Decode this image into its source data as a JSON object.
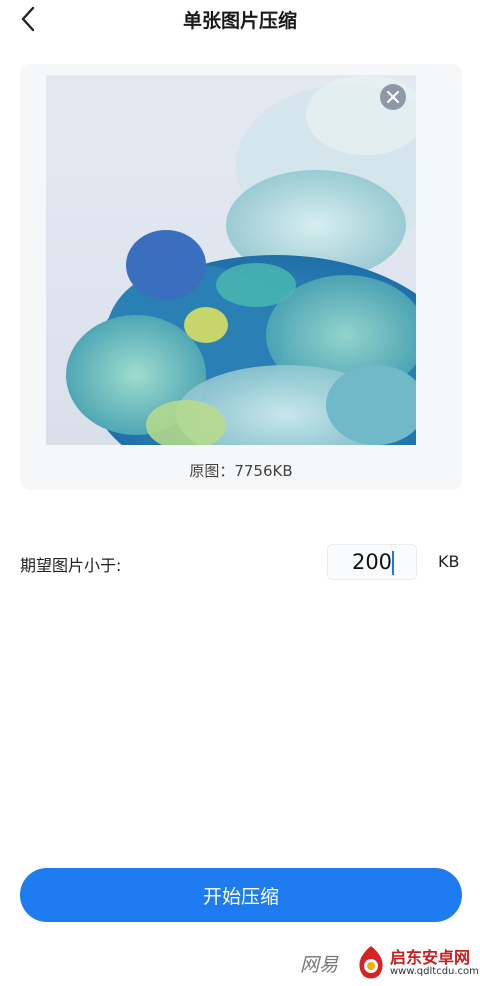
{
  "header": {
    "title": "单张图片压缩",
    "back_icon": "chevron-left-icon"
  },
  "preview": {
    "remove_icon": "close-icon",
    "original_label": "原图：7756KB"
  },
  "target": {
    "label": "期望图片小于:",
    "value": "200",
    "unit": "KB"
  },
  "actions": {
    "start_label": "开始压缩"
  },
  "watermark": {
    "left_text": "网易",
    "brand": "启东安卓网",
    "url": "www.qdltcdu.com"
  },
  "colors": {
    "accent": "#1e7cf0",
    "card_bg": "#f6f7f9",
    "remove_btn": "#8f98a6"
  }
}
